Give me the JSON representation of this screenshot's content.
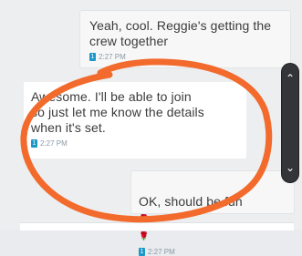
{
  "messages": [
    {
      "text": "Yeah, cool. Reggie's getting the\ncrew together",
      "time": "2:27 PM",
      "read_icon": "read-receipt-icon"
    },
    {
      "text": "Awesome. I'll be able to join\nso just let me know the details\nwhen it's set.",
      "time": "2:27 PM",
      "read_icon": "read-receipt-icon"
    },
    {
      "text": "OK, should be fun",
      "time": "2:27 PM",
      "read_icon": "read-receipt-icon",
      "emojis": [
        "🌹",
        "🌹"
      ]
    }
  ],
  "scrollbar": {
    "up_icon": "chevron-up-icon",
    "down_icon": "chevron-down-icon"
  },
  "annotation": {
    "shape": "hand-drawn-oval",
    "color": "#f26a2c"
  }
}
